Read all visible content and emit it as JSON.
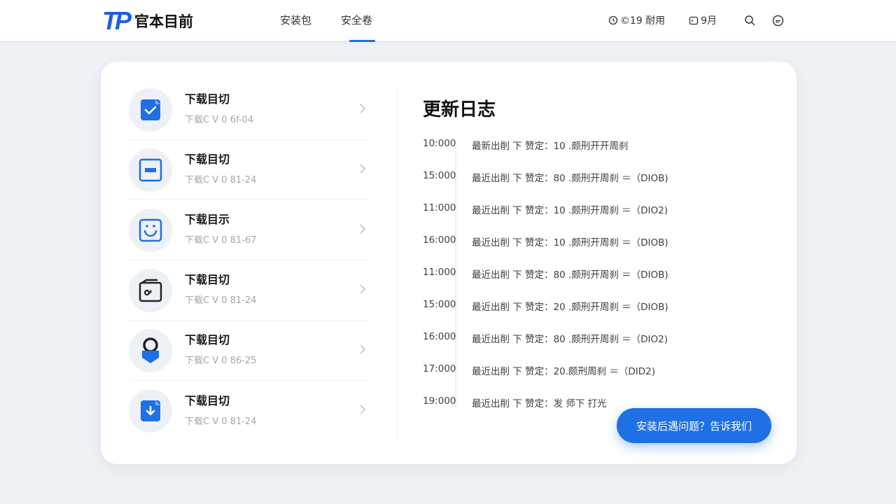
{
  "header": {
    "logo_mark": "TP",
    "logo_text": "官本目前",
    "tabs": [
      {
        "label": "安装包",
        "active": false
      },
      {
        "label": "安全卷",
        "active": true
      }
    ],
    "tools": [
      {
        "label": "©19 耐用",
        "icon": "clock-icon"
      },
      {
        "label": "9月",
        "icon": "calendar-icon"
      }
    ],
    "icons": [
      "search-icon",
      "chat-icon"
    ]
  },
  "downloads": [
    {
      "title": "下载目切",
      "sub": "下载C V  0 6f-04",
      "icon": "check-file-icon"
    },
    {
      "title": "下载目切",
      "sub": "下载C V  0 81-24",
      "icon": "window-icon"
    },
    {
      "title": "下载目示",
      "sub": "下载C V  0 81-67",
      "icon": "face-frame-icon"
    },
    {
      "title": "下载目切",
      "sub": "下载C V  0 81-24",
      "icon": "wallet-icon"
    },
    {
      "title": "下载目切",
      "sub": "下载C V  0 86-25",
      "icon": "lock-icon"
    },
    {
      "title": "下载目切",
      "sub": "下载C V  0 81-24",
      "icon": "download-file-icon"
    }
  ],
  "changelog": {
    "title": "更新日志",
    "entries": [
      {
        "time": "10:000",
        "text": "最新出削 下 赞定：10 .颇刑开开周刹"
      },
      {
        "time": "15:000",
        "text": "最近出削 下 赞定：80 .颇刑开周刹 ＝（DIOB)"
      },
      {
        "time": "11:000",
        "text": "最近出削 下 赞定：10 .颇刑开周刹 ＝（DIO2)"
      },
      {
        "time": "16:000",
        "text": "最近出削 下 赞定：10 .颇刑开周刹 ＝（DIOB)"
      },
      {
        "time": "11:000",
        "text": "最近出削 下 赞定：80 .颇刑开周刹 ＝（DIOB)"
      },
      {
        "time": "15:000",
        "text": "最近出削 下 赞定：20 .颇刑开周刹 ＝（DIOB)"
      },
      {
        "time": "16:000",
        "text": "最近出削 下 赞定：80 .颇刑开周刹 ＝（DIO2)"
      },
      {
        "time": "17:000",
        "text": "最近出削 下 赞定：20.颇刑周刹 ＝（DID2)"
      },
      {
        "time": "19:000",
        "text": "最近出削 下 赞定：发 师下 打光"
      }
    ]
  },
  "feedback_button": "安装后遇问题？告诉我们",
  "colors": {
    "accent": "#1f6fe5",
    "background": "#eef1f5"
  }
}
